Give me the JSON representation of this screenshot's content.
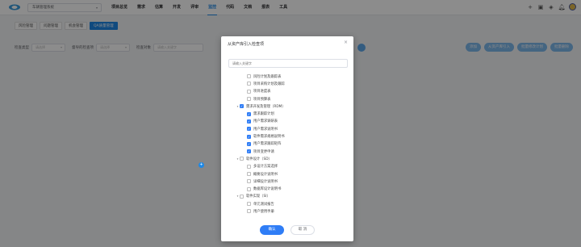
{
  "topbar": {
    "system_select": "车辆管理系统",
    "nav": [
      "项目总览",
      "需求",
      "估算",
      "开发",
      "评审",
      "监控",
      "代码",
      "文档",
      "报表",
      "工具"
    ],
    "active_nav": "监控"
  },
  "subtabs": [
    "风险管理",
    "问题管理",
    "机会管理",
    "QA质量管理"
  ],
  "active_subtab": "QA质量管理",
  "filters": {
    "items": [
      {
        "label": "检查类型",
        "placeholder": "请选择"
      },
      {
        "label": "督导的检查项",
        "placeholder": "请选择"
      },
      {
        "label": "检查对象",
        "placeholder": "请输入关键字"
      }
    ],
    "buttons": [
      "添加",
      "从资产库引入",
      "批量修改计划",
      "批量删除"
    ]
  },
  "modal": {
    "title": "从资产库引入检查项",
    "search_placeholder": "请输入关键字",
    "tree": [
      {
        "label": "风险计划及跟踪表",
        "level": 1,
        "state": "unchecked"
      },
      {
        "label": "项目采购计划及跟踪",
        "level": 1,
        "state": "unchecked"
      },
      {
        "label": "项目进度表",
        "level": 1,
        "state": "unchecked"
      },
      {
        "label": "项目预算表",
        "level": 1,
        "state": "unchecked"
      },
      {
        "label": "需求开发及管理（RDM）",
        "level": 0,
        "state": "checked",
        "expanded": true
      },
      {
        "label": "需求跟踪计划",
        "level": 1,
        "state": "checked"
      },
      {
        "label": "用户需求调研表",
        "level": 1,
        "state": "checked"
      },
      {
        "label": "用户需求说明书",
        "level": 1,
        "state": "checked"
      },
      {
        "label": "软件需求规格说明书",
        "level": 1,
        "state": "checked"
      },
      {
        "label": "用户需求跟踪矩阵",
        "level": 1,
        "state": "checked"
      },
      {
        "label": "项目变更申请",
        "level": 1,
        "state": "checked"
      },
      {
        "label": "软件设计（SD）",
        "level": 0,
        "state": "unchecked",
        "expanded": true
      },
      {
        "label": "多设计方案选择",
        "level": 1,
        "state": "unchecked"
      },
      {
        "label": "概要设计说明书",
        "level": 1,
        "state": "unchecked"
      },
      {
        "label": "详细设计说明书",
        "level": 1,
        "state": "unchecked"
      },
      {
        "label": "数据库设计说明书",
        "level": 1,
        "state": "unchecked"
      },
      {
        "label": "软件实现（SI）",
        "level": 0,
        "state": "unchecked",
        "expanded": true
      },
      {
        "label": "单元测试报告",
        "level": 1,
        "state": "unchecked"
      },
      {
        "label": "用户使用手册",
        "level": 1,
        "state": "unchecked"
      }
    ],
    "ok_label": "确认",
    "cancel_label": "取 消"
  }
}
